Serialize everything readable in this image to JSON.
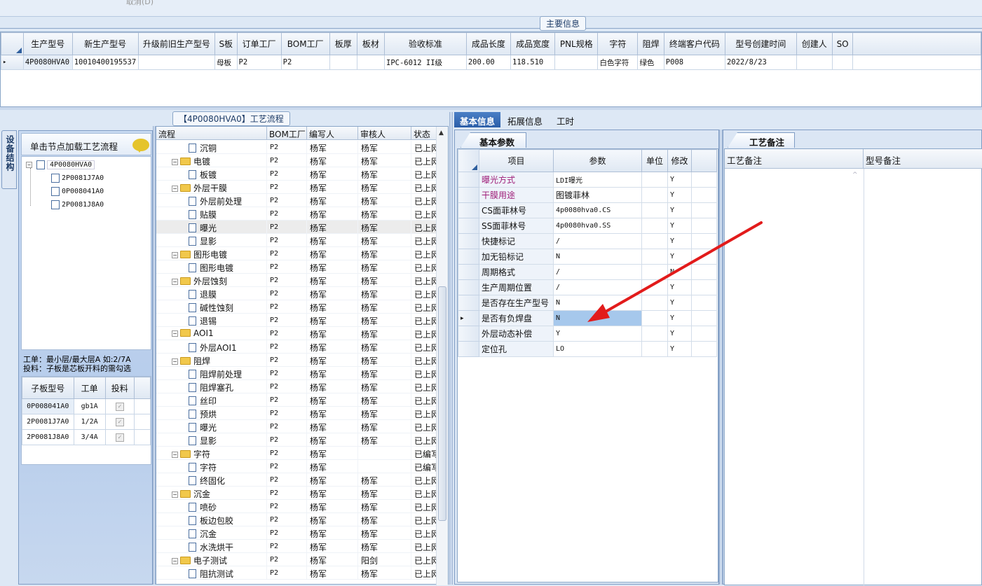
{
  "top": {
    "faint_text": "取消(D)"
  },
  "main_group_title": "主要信息",
  "main_table": {
    "headers": [
      "生产型号",
      "新生产型号",
      "升级前旧生产型号",
      "S板",
      "订单工厂",
      "BOM工厂",
      "板厚",
      "板材",
      "验收标准",
      "成品长度",
      "成品宽度",
      "PNL规格",
      "字符",
      "阻焊",
      "终端客户代码",
      "型号创建时间",
      "创建人",
      "SO"
    ],
    "row": [
      "4P0080HVA0",
      "10010400195537",
      "",
      "母板",
      "P2",
      "P2",
      "",
      "",
      "IPC-6012 II级",
      "200.00",
      "118.510",
      "",
      "白色字符",
      "绿色",
      "P008",
      "2022/8/23",
      "",
      ""
    ]
  },
  "vertical_tab": "设备结构",
  "left_panel": {
    "header": "单击节点加载工艺流程",
    "tree": [
      "4P0080HVA0",
      "2P0081J7A0",
      "0P008041A0",
      "2P0081J8A0"
    ],
    "note_line1": "工单：最小层/最大层A 如:2/7A",
    "note_line2": "投料：子板是芯板开料的需勾选",
    "sub_headers": [
      "子板型号",
      "工单",
      "投料"
    ],
    "sub_rows": [
      {
        "model": "0P008041A0",
        "order": "gb1A",
        "feed": "✓"
      },
      {
        "model": "2P0081J7A0",
        "order": "1/2A",
        "feed": "✓"
      },
      {
        "model": "2P0081J8A0",
        "order": "3/4A",
        "feed": "✓"
      }
    ]
  },
  "process_title": "【4P0080HVA0】工艺流程",
  "process_headers": [
    "流程",
    "BOM工厂",
    "编写人",
    "审核人",
    "状态"
  ],
  "process_rows": [
    {
      "name": "沉铜",
      "type": "doc",
      "level": 2,
      "bom": "P2",
      "author": "杨军",
      "reviewer": "杨军",
      "status": "已上网"
    },
    {
      "name": "电镀",
      "type": "folder",
      "level": 1,
      "bom": "P2",
      "author": "杨军",
      "reviewer": "杨军",
      "status": "已上网"
    },
    {
      "name": "板镀",
      "type": "doc",
      "level": 2,
      "bom": "P2",
      "author": "杨军",
      "reviewer": "杨军",
      "status": "已上网"
    },
    {
      "name": "外层干膜",
      "type": "folder",
      "level": 1,
      "bom": "P2",
      "author": "杨军",
      "reviewer": "杨军",
      "status": "已上网"
    },
    {
      "name": "外层前处理",
      "type": "doc",
      "level": 2,
      "bom": "P2",
      "author": "杨军",
      "reviewer": "杨军",
      "status": "已上网"
    },
    {
      "name": "贴膜",
      "type": "doc",
      "level": 2,
      "bom": "P2",
      "author": "杨军",
      "reviewer": "杨军",
      "status": "已上网"
    },
    {
      "name": "曝光",
      "type": "doc",
      "level": 2,
      "bom": "P2",
      "author": "杨军",
      "reviewer": "杨军",
      "status": "已上网",
      "selected": true
    },
    {
      "name": "显影",
      "type": "doc",
      "level": 2,
      "bom": "P2",
      "author": "杨军",
      "reviewer": "杨军",
      "status": "已上网"
    },
    {
      "name": "图形电镀",
      "type": "folder",
      "level": 1,
      "bom": "P2",
      "author": "杨军",
      "reviewer": "杨军",
      "status": "已上网"
    },
    {
      "name": "图形电镀",
      "type": "doc",
      "level": 2,
      "bom": "P2",
      "author": "杨军",
      "reviewer": "杨军",
      "status": "已上网"
    },
    {
      "name": "外层蚀刻",
      "type": "folder",
      "level": 1,
      "bom": "P2",
      "author": "杨军",
      "reviewer": "杨军",
      "status": "已上网"
    },
    {
      "name": "退膜",
      "type": "doc",
      "level": 2,
      "bom": "P2",
      "author": "杨军",
      "reviewer": "杨军",
      "status": "已上网"
    },
    {
      "name": "碱性蚀刻",
      "type": "doc",
      "level": 2,
      "bom": "P2",
      "author": "杨军",
      "reviewer": "杨军",
      "status": "已上网"
    },
    {
      "name": "退锡",
      "type": "doc",
      "level": 2,
      "bom": "P2",
      "author": "杨军",
      "reviewer": "杨军",
      "status": "已上网"
    },
    {
      "name": "AOI1",
      "type": "folder",
      "level": 1,
      "bom": "P2",
      "author": "杨军",
      "reviewer": "杨军",
      "status": "已上网"
    },
    {
      "name": "外层AOI1",
      "type": "doc",
      "level": 2,
      "bom": "P2",
      "author": "杨军",
      "reviewer": "杨军",
      "status": "已上网"
    },
    {
      "name": "阻焊",
      "type": "folder",
      "level": 1,
      "bom": "P2",
      "author": "杨军",
      "reviewer": "杨军",
      "status": "已上网"
    },
    {
      "name": "阻焊前处理",
      "type": "doc",
      "level": 2,
      "bom": "P2",
      "author": "杨军",
      "reviewer": "杨军",
      "status": "已上网"
    },
    {
      "name": "阻焊塞孔",
      "type": "doc",
      "level": 2,
      "bom": "P2",
      "author": "杨军",
      "reviewer": "杨军",
      "status": "已上网"
    },
    {
      "name": "丝印",
      "type": "doc",
      "level": 2,
      "bom": "P2",
      "author": "杨军",
      "reviewer": "杨军",
      "status": "已上网"
    },
    {
      "name": "预烘",
      "type": "doc",
      "level": 2,
      "bom": "P2",
      "author": "杨军",
      "reviewer": "杨军",
      "status": "已上网"
    },
    {
      "name": "曝光",
      "type": "doc",
      "level": 2,
      "bom": "P2",
      "author": "杨军",
      "reviewer": "杨军",
      "status": "已上网"
    },
    {
      "name": "显影",
      "type": "doc",
      "level": 2,
      "bom": "P2",
      "author": "杨军",
      "reviewer": "杨军",
      "status": "已上网"
    },
    {
      "name": "字符",
      "type": "folder",
      "level": 1,
      "bom": "P2",
      "author": "杨军",
      "reviewer": "",
      "status": "已编写"
    },
    {
      "name": "字符",
      "type": "doc",
      "level": 2,
      "bom": "P2",
      "author": "杨军",
      "reviewer": "",
      "status": "已编写"
    },
    {
      "name": "终固化",
      "type": "doc",
      "level": 2,
      "bom": "P2",
      "author": "杨军",
      "reviewer": "杨军",
      "status": "已上网"
    },
    {
      "name": "沉金",
      "type": "folder",
      "level": 1,
      "bom": "P2",
      "author": "杨军",
      "reviewer": "杨军",
      "status": "已上网"
    },
    {
      "name": "喷砂",
      "type": "doc",
      "level": 2,
      "bom": "P2",
      "author": "杨军",
      "reviewer": "杨军",
      "status": "已上网"
    },
    {
      "name": "板边包胶",
      "type": "doc",
      "level": 2,
      "bom": "P2",
      "author": "杨军",
      "reviewer": "杨军",
      "status": "已上网"
    },
    {
      "name": "沉金",
      "type": "doc",
      "level": 2,
      "bom": "P2",
      "author": "杨军",
      "reviewer": "杨军",
      "status": "已上网"
    },
    {
      "name": "水洗烘干",
      "type": "doc",
      "level": 2,
      "bom": "P2",
      "author": "杨军",
      "reviewer": "杨军",
      "status": "已上网"
    },
    {
      "name": "电子测试",
      "type": "folder",
      "level": 1,
      "bom": "P2",
      "author": "杨军",
      "reviewer": "阳剑",
      "status": "已上网"
    },
    {
      "name": "阻抗测试",
      "type": "doc",
      "level": 2,
      "bom": "P2",
      "author": "杨军",
      "reviewer": "杨军",
      "status": "已上网"
    }
  ],
  "right_tabs": [
    "基本信息",
    "拓展信息",
    "工时"
  ],
  "basic_subtab": "基本参数",
  "param_headers": [
    "项目",
    "参数",
    "单位",
    "修改"
  ],
  "params": [
    {
      "item": "曝光方式",
      "value": "LDI曝光",
      "unit": "",
      "modified": "Y",
      "highlight": true
    },
    {
      "item": "干膜用途",
      "value": "图镀菲林",
      "unit": "",
      "modified": "Y",
      "highlight": true
    },
    {
      "item": "CS面菲林号",
      "value": "4p0080hva0.CS",
      "unit": "",
      "modified": "Y"
    },
    {
      "item": "SS面菲林号",
      "value": "4p0080hva0.SS",
      "unit": "",
      "modified": "Y"
    },
    {
      "item": "快捷标记",
      "value": "/",
      "unit": "",
      "modified": "Y"
    },
    {
      "item": "加无铅标记",
      "value": "N",
      "unit": "",
      "modified": "Y"
    },
    {
      "item": "周期格式",
      "value": "/",
      "unit": "",
      "modified": "N"
    },
    {
      "item": "生产周期位置",
      "value": "/",
      "unit": "",
      "modified": "Y"
    },
    {
      "item": "是否存在生产型号",
      "value": "N",
      "unit": "",
      "modified": "Y"
    },
    {
      "item": "是否有负焊盘",
      "value": "N",
      "unit": "",
      "modified": "Y",
      "selected": true
    },
    {
      "item": "外层动态补偿",
      "value": "Y",
      "unit": "",
      "modified": "Y"
    },
    {
      "item": "定位孔",
      "value": "LO",
      "unit": "",
      "modified": "Y"
    }
  ],
  "remark_tab": "工艺备注",
  "remark_headers": [
    "工艺备注",
    "型号备注"
  ],
  "colors": {
    "highlight_text": "#a0207a",
    "selection": "#a6c8ec",
    "active_tab": "#2b5ea8",
    "arrow": "#e21b1b"
  }
}
